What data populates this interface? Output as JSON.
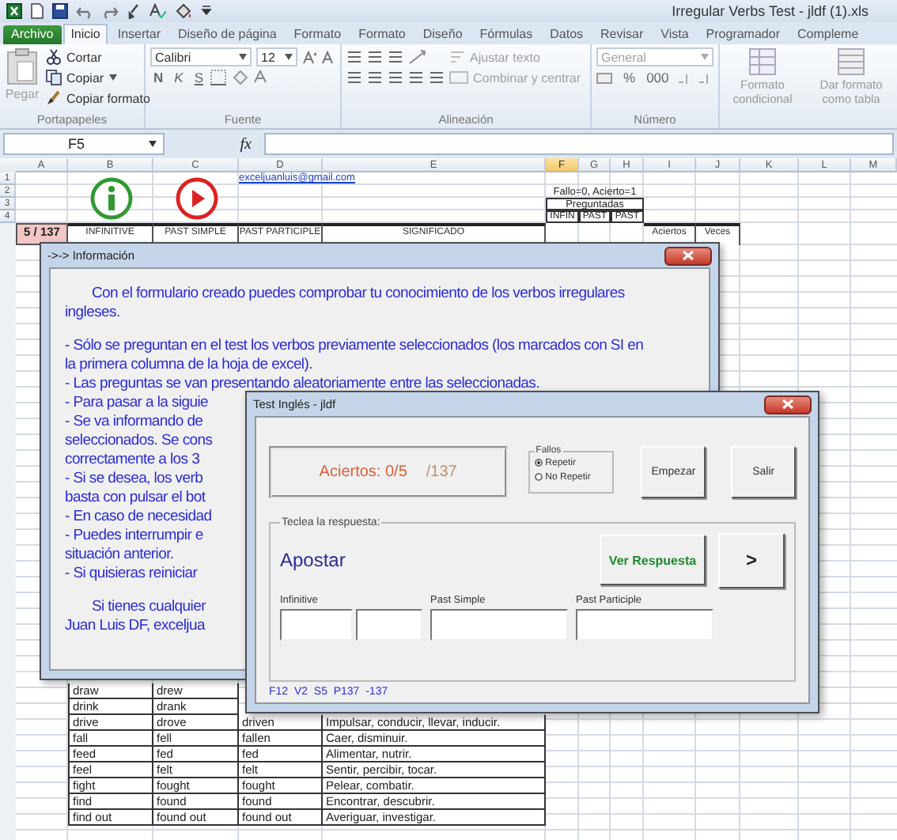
{
  "window": {
    "title": "Irregular Verbs Test - jldf (1).xls"
  },
  "ribbon_tabs": [
    {
      "label": "Archivo",
      "kind": "file",
      "selected": false
    },
    {
      "label": "Inicio",
      "kind": "tab",
      "selected": true
    },
    {
      "label": "Insertar",
      "kind": "tab",
      "selected": false
    },
    {
      "label": "Diseño de página",
      "kind": "tab",
      "selected": false
    },
    {
      "label": "Formato",
      "kind": "tab",
      "selected": false
    },
    {
      "label": "Formato",
      "kind": "tab",
      "selected": false
    },
    {
      "label": "Diseño",
      "kind": "tab",
      "selected": false
    },
    {
      "label": "Fórmulas",
      "kind": "tab",
      "selected": false
    },
    {
      "label": "Datos",
      "kind": "tab",
      "selected": false
    },
    {
      "label": "Revisar",
      "kind": "tab",
      "selected": false
    },
    {
      "label": "Vista",
      "kind": "tab",
      "selected": false
    },
    {
      "label": "Programador",
      "kind": "tab",
      "selected": false
    },
    {
      "label": "Compleme",
      "kind": "tab",
      "selected": false
    }
  ],
  "ribbon": {
    "clipboard": {
      "label": "Portapapeles",
      "paste": "Pegar",
      "cut": "Cortar",
      "copy": "Copiar",
      "format_painter": "Copiar formato"
    },
    "font": {
      "label": "Fuente",
      "name": "Calibri",
      "size": "12",
      "bold": "N",
      "italic": "K",
      "underline": "S"
    },
    "alignment": {
      "label": "Alineación",
      "wrap": "Ajustar texto",
      "merge": "Combinar y centrar"
    },
    "number": {
      "label": "Número",
      "format": "General",
      "percent": "%",
      "thousands": "000"
    },
    "styles": {
      "conditional": "Formato condicional",
      "table": "Dar formato como tabla"
    }
  },
  "formula_bar": {
    "cell": "F5",
    "function_label": "fx"
  },
  "sheet": {
    "columns": [
      {
        "label": "A",
        "selected": false
      },
      {
        "label": "B",
        "selected": false
      },
      {
        "label": "C",
        "selected": false
      },
      {
        "label": "D",
        "selected": false
      },
      {
        "label": "E",
        "selected": false
      },
      {
        "label": "F",
        "selected": true
      },
      {
        "label": "G",
        "selected": false
      },
      {
        "label": "H",
        "selected": false
      },
      {
        "label": "I",
        "selected": false
      },
      {
        "label": "J",
        "selected": false
      },
      {
        "label": "K",
        "selected": false
      },
      {
        "label": "L",
        "selected": false
      },
      {
        "label": "M",
        "selected": false
      }
    ],
    "row_numbers": [
      "1",
      "2",
      "3",
      "4"
    ],
    "email": "exceljuanluis@gmail.com",
    "legend": "Fallo=0, Acierto=1",
    "asked_header": "Preguntadas",
    "asked_columns": [
      "INFIN",
      "PAST",
      "PAST"
    ],
    "counter": "5 / 137",
    "headers": [
      "INFINITIVE",
      "PAST SIMPLE",
      "PAST PARTICIPLE",
      "SIGNIFICADO"
    ],
    "score_headers": [
      "Aciertos",
      "Veces"
    ],
    "rows": [
      [
        "draw",
        "drew"
      ],
      [
        "drink",
        "drank"
      ],
      [
        "drive",
        "drove",
        "driven",
        "Impulsar, conducir, llevar, inducir."
      ],
      [
        "fall",
        "fell",
        "fallen",
        "Caer, disminuir."
      ],
      [
        "feed",
        "fed",
        "fed",
        "Alimentar, nutrir."
      ],
      [
        "feel",
        "felt",
        "felt",
        "Sentir, percibir, tocar."
      ],
      [
        "fight",
        "fought",
        "fought",
        "Pelear, combatir."
      ],
      [
        "find",
        "found",
        "found",
        "Encontrar, descubrir."
      ],
      [
        "find out",
        "found out",
        "found out",
        "Averiguar, investigar."
      ]
    ]
  },
  "info_dialog": {
    "title": "->-> Información",
    "paragraphs": [
      {
        "kind": "indent",
        "lines": [
          "Con el formulario creado puedes comprobar tu conocimiento de los verbos irregulares",
          "ingleses."
        ]
      },
      {
        "kind": "plain",
        "lines": [
          "- Sólo se preguntan en el test los verbos previamente seleccionados (los marcados con SI en",
          "la primera columna de la hoja de excel).",
          "- Las preguntas se van presentando aleatoriamente entre las seleccionadas.",
          "- Para pasar a la siguie",
          "- Se va informando de",
          "seleccionados. Se cons",
          "correctamente a los 3",
          "- Si se desea, los verb",
          "basta con pulsar el bot",
          "- En caso de necesidad",
          "- Puedes interrumpir e",
          "situación anterior.",
          "- Si quisieras reiniciar"
        ]
      },
      {
        "kind": "indent",
        "lines": [
          "Si tienes cualquier",
          "Juan Luis DF, exceljua"
        ]
      }
    ]
  },
  "test_dialog": {
    "title": "Test Inglés - jldf",
    "score": "Aciertos: 0/5",
    "total": "/137",
    "fallos": {
      "label": "Fallos",
      "options": [
        {
          "label": "Repetir",
          "selected": true
        },
        {
          "label": "No Repetir",
          "selected": false
        }
      ]
    },
    "start_button": "Empezar",
    "exit_button": "Salir",
    "frame_label": "Teclea la respuesta:",
    "verb": "Apostar",
    "reveal_button": "Ver Respuesta",
    "next_button": ">",
    "fields": [
      {
        "label": "Infinitive",
        "kind": "split"
      },
      {
        "label": "Past Simple",
        "kind": "single"
      },
      {
        "label": "Past Participle",
        "kind": "single"
      }
    ],
    "status": "F12  V2  S5  P137  -137"
  }
}
